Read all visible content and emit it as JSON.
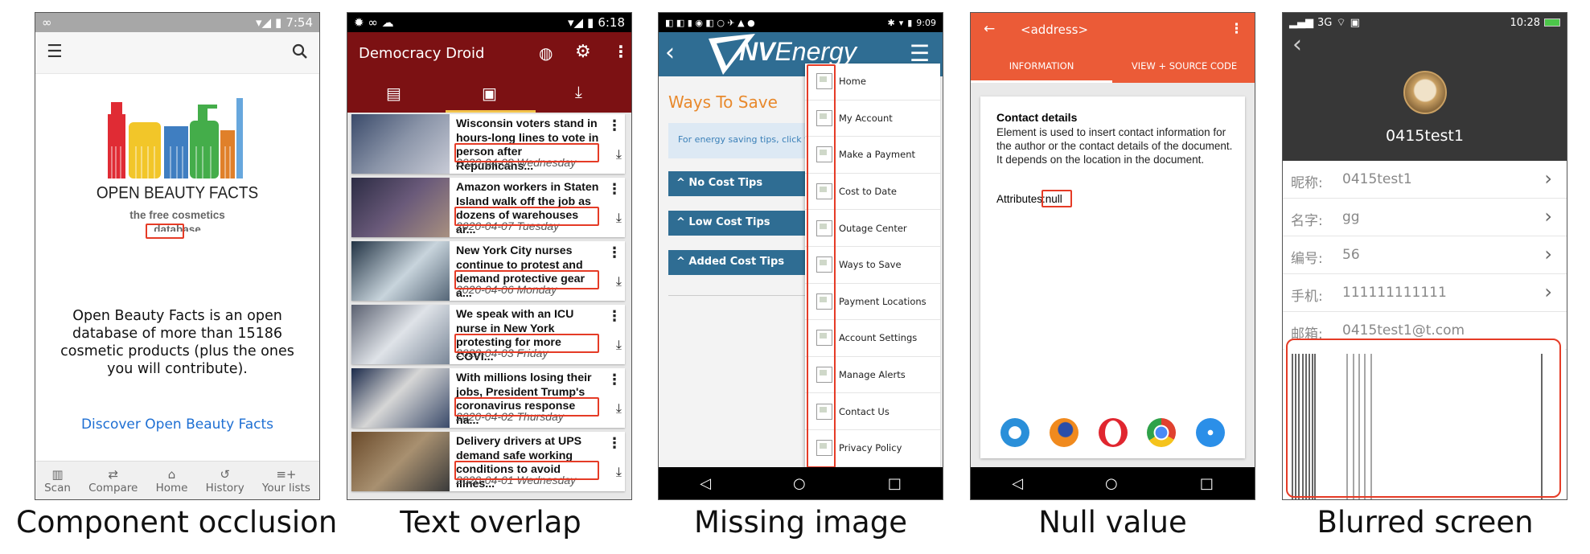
{
  "captions": [
    "Component occlusion",
    "Text overlap",
    "Missing image",
    "Null value",
    "Blurred screen"
  ],
  "phone1": {
    "status_time": "7:54",
    "logo_text": "OPEN BEAUTY FACTS",
    "logo_sub": "the free cosmetics",
    "logo_sub2": "database",
    "description": "Open Beauty Facts is an open database of more than 15186 cosmetic products (plus the ones you will contribute).",
    "discover_link": "Discover Open Beauty Facts",
    "nav": [
      "Scan",
      "Compare",
      "Home",
      "History",
      "Your lists"
    ]
  },
  "phone2": {
    "status_time": "6:18",
    "app_title": "Democracy Droid",
    "news": [
      {
        "title": "Wisconsin voters stand in hours-long lines to vote in person after Republicans...",
        "date": "2020-04-08 Wednesday"
      },
      {
        "title": "Amazon workers in Staten Island walk off the job as dozens of warehouses ar...",
        "date": "2020-04-07 Tuesday"
      },
      {
        "title": "New York City nurses continue to protest and demand protective gear a...",
        "date": "2020-04-06 Monday"
      },
      {
        "title": "We speak with an ICU nurse in New York protesting for more COVI...",
        "date": "2020-04-03 Friday"
      },
      {
        "title": "With millions losing their jobs, President Trump's coronavirus response ha...",
        "date": "2020-04-02 Thursday"
      },
      {
        "title": "Delivery drivers at UPS demand safe working conditions to avoid illnes...",
        "date": "2020-04-01 Wednesday"
      }
    ]
  },
  "phone3": {
    "status_time": "9:09",
    "brand_nv": "NV",
    "brand_energy": "Energy",
    "ways_title": "Ways To Save",
    "tip_text": "For energy saving tips, click t",
    "tip_buttons": [
      "No Cost Tips",
      "Low Cost Tips",
      "Added Cost Tips"
    ],
    "menu": [
      "Home",
      "My Account",
      "Make a Payment",
      "Cost to Date",
      "Outage Center",
      "Ways to Save",
      "Payment Locations",
      "Account Settings",
      "Manage Alerts",
      "Contact Us",
      "Privacy Policy"
    ]
  },
  "phone4": {
    "title": "<address>",
    "tabs": [
      "INFORMATION",
      "VIEW + SOURCE CODE"
    ],
    "card_title": "Contact details",
    "card_text": "Element is used to insert contact information for the author or the contact details of the document. It depends on the location in the document.",
    "attr_label": "Attributes:",
    "attr_value": "null"
  },
  "phone5": {
    "status_network": "3G",
    "status_time": "10:28",
    "username": "0415test1",
    "rows": [
      {
        "label": "昵称:",
        "value": "0415test1",
        "chevron": true
      },
      {
        "label": "名字:",
        "value": "gg",
        "chevron": true
      },
      {
        "label": "编号:",
        "value": "56",
        "chevron": true
      },
      {
        "label": "手机:",
        "value": "111111111111",
        "chevron": true
      },
      {
        "label": "邮箱:",
        "value": "0415test1@t.com",
        "chevron": false
      }
    ]
  }
}
